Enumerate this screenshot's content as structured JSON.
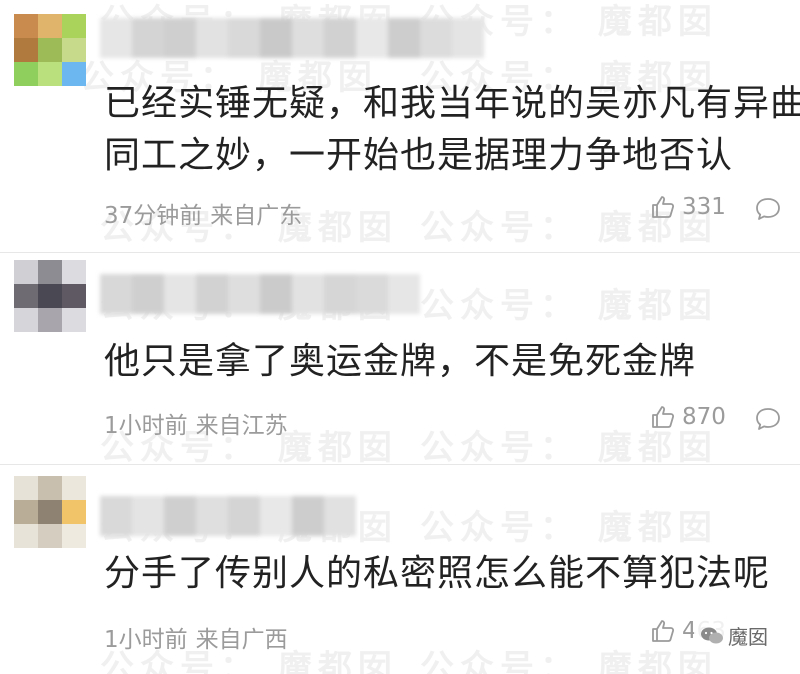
{
  "watermark": {
    "text_a": "公众号：",
    "text_b": "魔都囡"
  },
  "badge": {
    "label": "魔囡",
    "icon": "wechat-icon"
  },
  "comments": [
    {
      "avatar_colors": [
        "#c98c4e",
        "#e0b46a",
        "#a9d35a",
        "#b07a3e",
        "#9dbb57",
        "#c7d98a",
        "#8fcf5d",
        "#b9e07d",
        "#6db7f0"
      ],
      "username_colors": [
        "#e6e6e6",
        "#d4d4d4",
        "#cfcfcf",
        "#e2e2e2",
        "#d9d9d9",
        "#c9c9c9",
        "#dedede",
        "#d1d1d1",
        "#e8e8e8",
        "#cdcdcd",
        "#dcdcdc",
        "#e4e4e4"
      ],
      "text_lines": [
        "已经实锤无疑，和我当年说的吴亦凡有异曲",
        "同工之妙，一开始也是据理力争地否认"
      ],
      "time": "37分钟前",
      "location": "来自广东",
      "likes": "331",
      "like_icon": "thumbs-up-icon",
      "reply_icon": "comment-bubble-icon"
    },
    {
      "avatar_colors": [
        "#cfcfd4",
        "#8d8c93",
        "#dcdce0",
        "#6f6b73",
        "#4a4853",
        "#5e5963",
        "#d6d5d9",
        "#a9a5ac",
        "#dcdce0"
      ],
      "username_colors": [
        "#d8d8d8",
        "#cfcfcf",
        "#e5e5e5",
        "#d2d2d2",
        "#dedede",
        "#cbcbcb",
        "#e2e2e2",
        "#d6d6d6",
        "#dadada",
        "#e6e6e6"
      ],
      "text_lines": [
        "他只是拿了奥运金牌，不是免死金牌"
      ],
      "time": "1小时前",
      "location": "来自江苏",
      "likes": "870",
      "like_icon": "thumbs-up-icon",
      "reply_icon": "comment-bubble-icon"
    },
    {
      "avatar_colors": [
        "#e6e2d8",
        "#c9bfae",
        "#ece7dc",
        "#b9ad98",
        "#8e8373",
        "#f2c46a",
        "#e8e3d8",
        "#d5cdbf",
        "#eeeae0"
      ],
      "username_colors": [
        "#d9d9d9",
        "#e4e4e4",
        "#cfcfcf",
        "#dfdfdf",
        "#d4d4d4",
        "#e8e8e8",
        "#cdcdcd",
        "#e1e1e1"
      ],
      "text_lines": [
        "分手了传别人的私密照怎么能不算犯法呢"
      ],
      "time": "1小时前",
      "location": "来自广西",
      "likes": "463",
      "like_icon": "thumbs-up-icon",
      "reply_icon": "comment-bubble-icon"
    }
  ]
}
